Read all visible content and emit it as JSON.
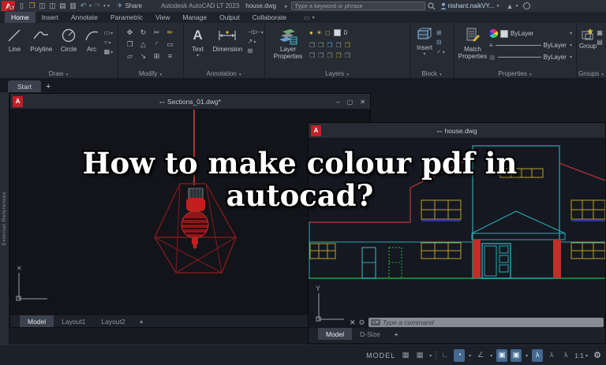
{
  "titlebar": {
    "logo_letter": "A",
    "logo_badge": "LT",
    "share": "Share",
    "app_title": "Autodesk AutoCAD LT 2023",
    "doc": "house.dwg",
    "search_placeholder": "Type a keyword or phrase",
    "user": "nishant.naikVY..."
  },
  "icons": {
    "new": "▯",
    "open": "❒",
    "save": "◫",
    "save_as": "◫",
    "plot": "▤",
    "sheet": "▥",
    "undo": "↶",
    "redo": "↷",
    "caret": "▾",
    "caret_right": "▸",
    "plane": "✈",
    "triangle": "▲",
    "minimize": "–",
    "restore": "▢",
    "close": "✕",
    "grid": "▦",
    "ortho": "∟",
    "polar": "◔",
    "iso": "∠",
    "osnap": "▣",
    "person": "λ",
    "gear": "⚙",
    "plus": "+",
    "wrench": "⚙",
    "x": "✕",
    "bulb": "●",
    "sun": "☀",
    "lock": "◻",
    "chip": "❒",
    "move": "✥",
    "rotate": "↻",
    "scissors": "✂",
    "pencil": "✏",
    "copy": "❐",
    "mirror": "△",
    "fillet": "◜",
    "rect": "▭",
    "stretch": "▱",
    "scale": "↘",
    "array": "⊞",
    "lines": "≡",
    "linear_dim": "⊣1⊢",
    "leader": "↗",
    "table": "⊞",
    "ellipse": "○",
    "hatch": "▦",
    "block_plus": "⊞",
    "block_minus": "⊟",
    "check": "✓",
    "star": "✦",
    "cmd_chip": "▭▾"
  },
  "ribbon": {
    "tabs": [
      {
        "label": "Home",
        "active": true
      },
      {
        "label": "Insert"
      },
      {
        "label": "Annotate"
      },
      {
        "label": "Parametric"
      },
      {
        "label": "View"
      },
      {
        "label": "Manage"
      },
      {
        "label": "Output"
      },
      {
        "label": "Collaborate"
      }
    ],
    "panels": {
      "draw": {
        "label": "Draw",
        "buttons": [
          {
            "label": "Line"
          },
          {
            "label": "Polyline"
          },
          {
            "label": "Circle"
          },
          {
            "label": "Arc"
          }
        ]
      },
      "modify": {
        "label": "Modify"
      },
      "annotation": {
        "label": "Annotation",
        "text": "Text",
        "dimension": "Dimension"
      },
      "layers": {
        "label": "Layers",
        "big1": "Layer",
        "big2": "Properties",
        "zero": "0"
      },
      "block": {
        "label": "Block",
        "big": "Insert"
      },
      "properties": {
        "label": "Properties",
        "big1": "Match",
        "big2": "Properties",
        "bylayer": "ByLayer"
      },
      "groups": {
        "label": "Groups",
        "big": "Group"
      }
    }
  },
  "file_tabs": {
    "start": "Start",
    "plus": "+"
  },
  "palette": {
    "label": "External References"
  },
  "overlay": {
    "line1": "How to make colour pdf in",
    "line2": "autocad?"
  },
  "sections_window": {
    "title": "Sections_01.dwg*",
    "tabs": [
      {
        "label": "Model",
        "active": true
      },
      {
        "label": "Layout1"
      },
      {
        "label": "Layout2"
      }
    ],
    "plus": "+"
  },
  "house_window": {
    "title": "house.dwg",
    "logo": "A",
    "command_placeholder": "Type a command",
    "tabs": [
      {
        "label": "Model",
        "active": true
      },
      {
        "label": "D-Size"
      }
    ],
    "plus": "+"
  },
  "statusbar": {
    "model": "MODEL",
    "scale": "1:1"
  },
  "colors": {
    "autocad_red": "#c02026",
    "cyan": "#2aa7b5",
    "window_yellow": "#b9a02a",
    "ground_green": "#1f9e46",
    "roof_red": "#a83232",
    "column_red": "#c03028",
    "sill_blue": "#2e3fbf",
    "lamp_dark_red": "#7d1a1d",
    "bulb_red": "#c41f1f",
    "status_active_blue": "#44688e"
  }
}
